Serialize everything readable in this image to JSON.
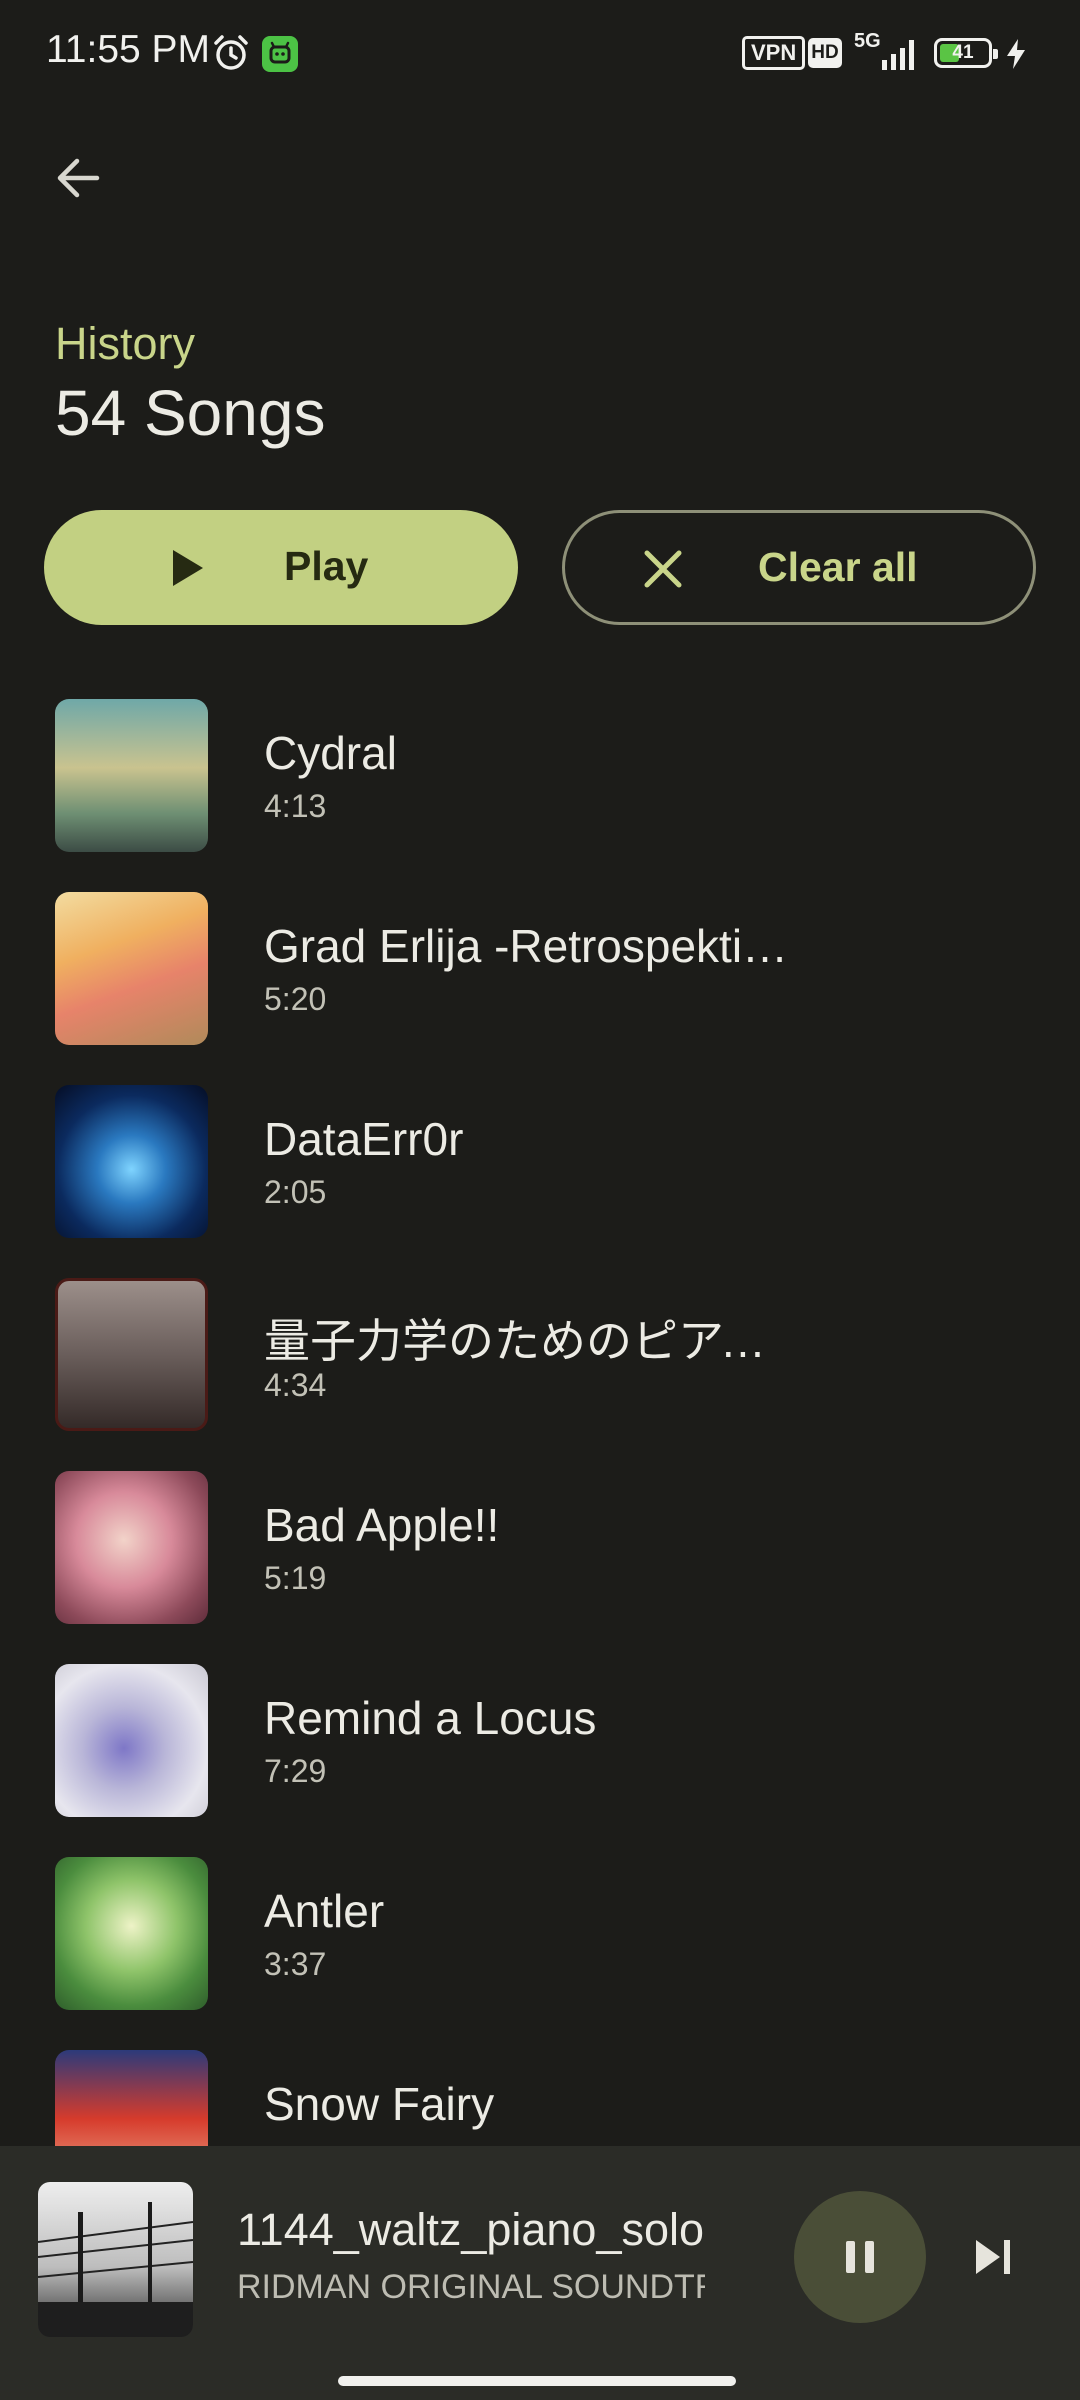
{
  "status_bar": {
    "time": "11:55 PM",
    "vpn": "VPN",
    "hd": "HD",
    "network": "5G",
    "battery": "41",
    "battery_level": 0.41,
    "colors": {
      "battery_fill": "#5ac444",
      "app_icon": "#4cc245"
    }
  },
  "header": {
    "subtitle": "History",
    "title": "54 Songs"
  },
  "actions": {
    "play_label": "Play",
    "clear_label": "Clear all"
  },
  "songs": [
    {
      "title": "Cydral",
      "duration": "4:13"
    },
    {
      "title": "Grad Erlija -Retrospekti…",
      "duration": "5:20"
    },
    {
      "title": "DataErr0r",
      "duration": "2:05"
    },
    {
      "title": "量子力学のためのピアノ…",
      "duration": "4:34"
    },
    {
      "title": "Bad Apple!!",
      "duration": "5:19"
    },
    {
      "title": "Remind a Locus",
      "duration": "7:29"
    },
    {
      "title": "Antler",
      "duration": "3:37"
    },
    {
      "title": "Snow Fairy",
      "duration": ""
    }
  ],
  "now_playing": {
    "title": "1144_waltz_piano_solo",
    "subtitle": "RIDMAN ORIGINAL SOUNDTRA"
  },
  "theme": {
    "background": "#1c1c19",
    "accent": "#c2d082",
    "accent_text": "#c9d58a",
    "player_bg": "#2b2c27"
  },
  "icons": {
    "back": "arrow-left-icon",
    "play": "play-icon",
    "clear": "close-icon",
    "pause": "pause-icon",
    "next": "skip-next-icon",
    "alarm": "alarm-clock-icon"
  }
}
